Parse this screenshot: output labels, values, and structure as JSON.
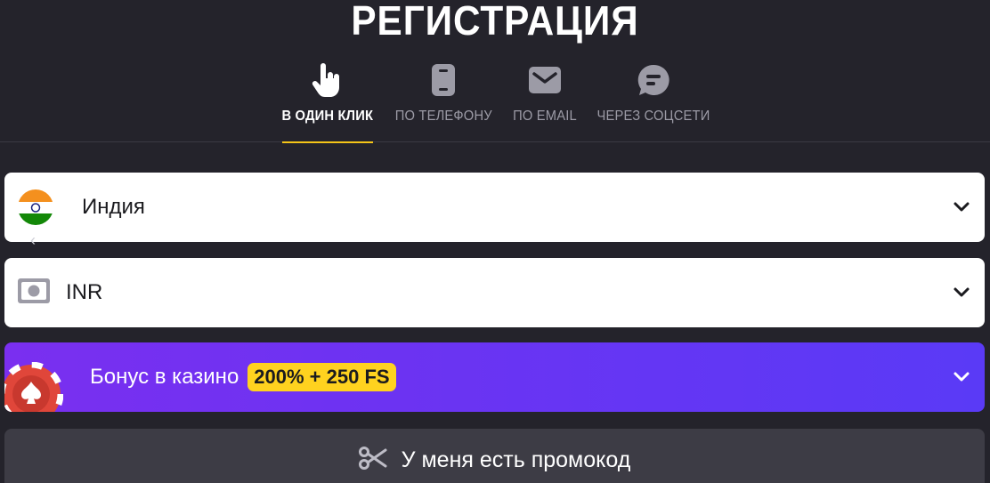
{
  "page": {
    "title": "РЕГИСТРАЦИЯ"
  },
  "tabs": [
    {
      "label": "В ОДИН КЛИК",
      "icon": "hand-pointer-icon",
      "active": true
    },
    {
      "label": "ПО ТЕЛЕФОНУ",
      "icon": "phone-icon",
      "active": false
    },
    {
      "label": "ПО EMAIL",
      "icon": "envelope-icon",
      "active": false
    },
    {
      "label": "ЧЕРЕЗ СОЦСЕТИ",
      "icon": "chat-bubble-icon",
      "active": false
    }
  ],
  "country": {
    "value": "Индия",
    "icon": "india-flag-icon"
  },
  "currency": {
    "value": "INR",
    "icon": "banknote-icon"
  },
  "bonus": {
    "label": "Бонус в казино",
    "badge": "200% + 250 FS",
    "icon": "casino-chip-icon"
  },
  "promo": {
    "label": "У меня есть промокод",
    "icon": "scissors-icon"
  },
  "colors": {
    "background": "#24232b",
    "accent": "#f5c518",
    "bonus_gradient_start": "#7a2ff0",
    "bonus_gradient_end": "#5a3af6",
    "badge": "#ffd21f"
  }
}
